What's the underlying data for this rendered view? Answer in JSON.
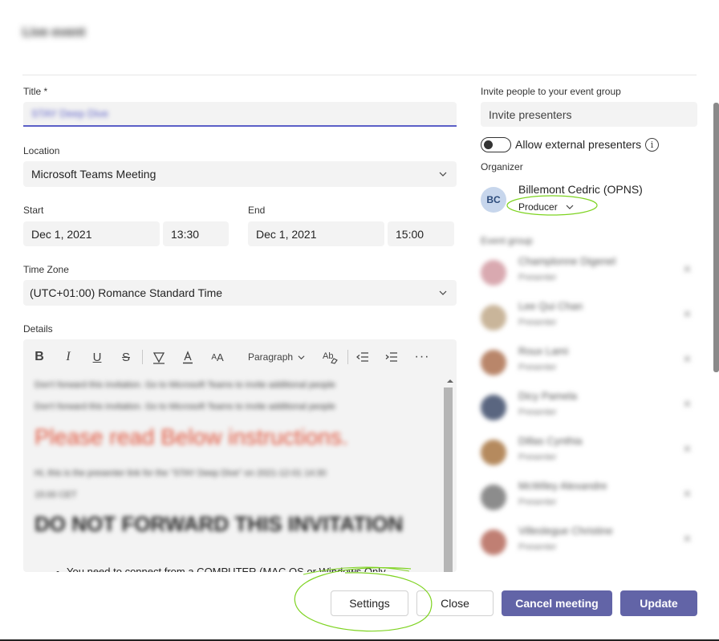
{
  "dialog": {
    "title": "Live event"
  },
  "form": {
    "title_label": "Title *",
    "title_value": "STAY Deep Dive",
    "location_label": "Location",
    "location_value": "Microsoft Teams Meeting",
    "start_label": "Start",
    "start_date": "Dec 1, 2021",
    "start_time": "13:30",
    "end_label": "End",
    "end_date": "Dec 1, 2021",
    "end_time": "15:00",
    "timezone_label": "Time Zone",
    "timezone_value": "(UTC+01:00) Romance Standard Time",
    "details_label": "Details"
  },
  "toolbar": {
    "paragraph_label": "Paragraph",
    "items": [
      "bold",
      "italic",
      "underline",
      "strikethrough",
      "highlight",
      "font-color",
      "font-size",
      "paragraph",
      "format-painter",
      "decrease-indent",
      "increase-indent",
      "more"
    ]
  },
  "details": {
    "line1": "Don't forward this invitation. Go to Microsoft Teams to invite additional people",
    "line2": "Don't forward this invitation. Go to Microsoft Teams to invite additional people",
    "red_heading": "Please read Below instructions.",
    "line3": "Hi, this is the presenter link for the \"STAY Deep Dive\" on 2021-12-01 14:30",
    "line4": "15:00 CET",
    "big_heading": "DO NOT FORWARD THIS INVITATION",
    "bullet": "You need to connect from a COMPUTER (MAC OS or Windows Only"
  },
  "invite": {
    "label": "Invite people to your event group",
    "placeholder": "Invite presenters",
    "allow_external": "Allow external presenters",
    "info_glyph": "i"
  },
  "organizer": {
    "label": "Organizer",
    "initials": "BC",
    "name": "Billemont Cedric (OPNS)",
    "role": "Producer"
  },
  "event_group": {
    "label": "Event group",
    "members": [
      {
        "name": "Champlonne Digenel",
        "role": "Presenter",
        "color": "#d9a9b0"
      },
      {
        "name": "Lee Qui Chan",
        "role": "Presenter",
        "color": "#c9b59a"
      },
      {
        "name": "Roux Lami",
        "role": "Presenter",
        "color": "#b9866a"
      },
      {
        "name": "Dicy Pamela",
        "role": "Presenter",
        "color": "#5a6680"
      },
      {
        "name": "Dillas Cynthia",
        "role": "Presenter",
        "color": "#b58a5e"
      },
      {
        "name": "McWiley Alexandre",
        "role": "Presenter",
        "color": "#8c8c8c"
      },
      {
        "name": "Villeslegue Christine",
        "role": "Presenter",
        "color": "#c07f73"
      }
    ]
  },
  "footer": {
    "settings": "Settings",
    "close": "Close",
    "cancel_meeting": "Cancel meeting",
    "update": "Update"
  },
  "colors": {
    "accent": "#6264a7",
    "focus": "#5b5fc7",
    "annotation": "#7ed321"
  }
}
